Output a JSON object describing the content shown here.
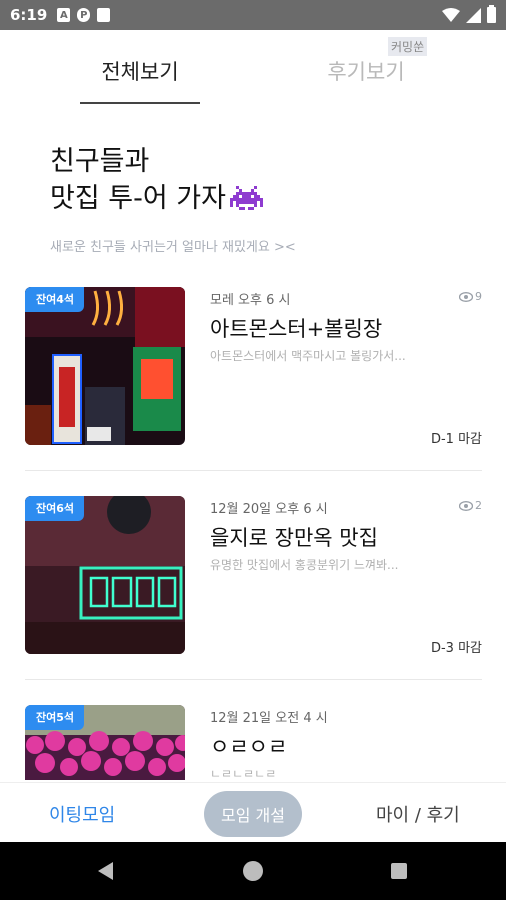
{
  "status_bar": {
    "time": "6:19",
    "left_icons": [
      "font-icon",
      "pinterest-like-icon",
      "sim-card-icon"
    ],
    "right_icons": [
      "wifi-icon",
      "signal-icon",
      "battery-icon"
    ]
  },
  "tabs": {
    "all": "전체보기",
    "review": "후기보기",
    "coming_soon": "커밍쑨"
  },
  "hero": {
    "line1": "친구들과",
    "line2": "맛집 투-어 가자",
    "subtitle": "새로운 친구들 사귀는거 얼마나 재밌게요 ><"
  },
  "meetings": [
    {
      "seats": "잔여4석",
      "date": "모레 오후 6 시",
      "views": "9",
      "title": "아트몬스터+볼링장",
      "desc": "아트몬스터에서 맥주마시고 볼링가서...",
      "deadline": "D-1 마감"
    },
    {
      "seats": "잔여6석",
      "date": "12월 20일 오후 6 시",
      "views": "2",
      "title": "을지로 장만옥 맛집",
      "desc": "유명한 맛집에서 홍콩분위기 느껴봐...",
      "deadline": "D-3 마감"
    },
    {
      "seats": "잔여5석",
      "date": "12월 21일 오전 4 시",
      "views": "",
      "title": "ㅇㄹㅇㄹ",
      "desc": "ㄴㄹㄴㄹㄴㄹ",
      "deadline": ""
    }
  ],
  "bottom_nav": {
    "meeting": "이팅모임",
    "create": "모임 개설",
    "my": "마이 / 후기"
  },
  "colors": {
    "accent": "#2d8cf0",
    "nav_active": "#2f86e8",
    "create_button": "#b3bfcc"
  }
}
